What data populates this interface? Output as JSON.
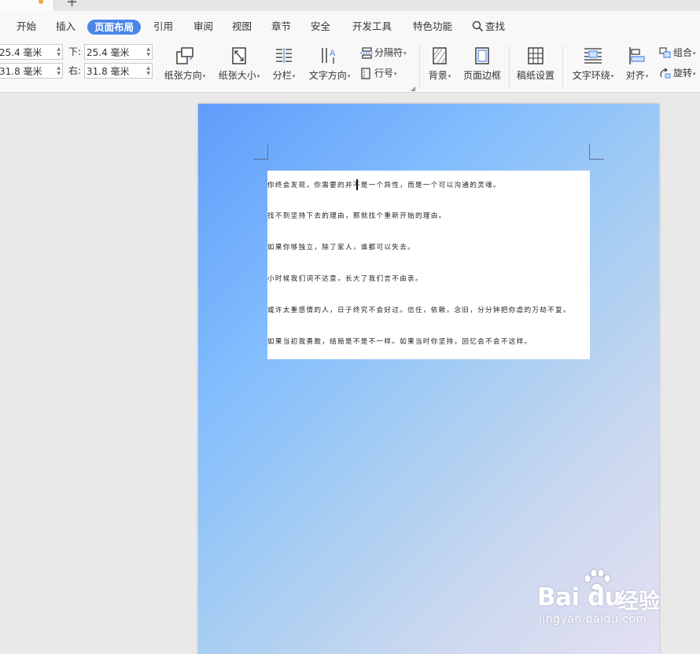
{
  "menu": {
    "items": [
      "开始",
      "插入",
      "页面布局",
      "引用",
      "审阅",
      "视图",
      "章节",
      "安全",
      "开发工具",
      "特色功能"
    ],
    "active": "页面布局",
    "search_label": "查找"
  },
  "margins": {
    "top_value": "25.4 毫米",
    "left_value": "31.8 毫米",
    "bottom_label": "下:",
    "bottom_value": "25.4 毫米",
    "right_label": "右:",
    "right_value": "31.8 毫米"
  },
  "toolbar": {
    "orientation": "纸张方向",
    "size": "纸张大小",
    "columns": "分栏",
    "text_direction": "文字方向",
    "breaks": "分隔符",
    "line_numbers": "行号",
    "background": "背景",
    "page_border": "页面边框",
    "manuscript": "稿纸设置",
    "wrap_text": "文字环绕",
    "align": "对齐",
    "group": "组合",
    "rotate": "旋转"
  },
  "document": {
    "lines": [
      "你终会发现，你需要的并不是一个异性，而是一个可以沟通的灵魂。",
      "找不到坚持下去的理由，那就找个重新开始的理由。",
      "如果你够独立，除了家人，谁都可以失去。",
      "小时候我们词不达意，长大了我们言不由衷。",
      "或许太重感情的人，日子终究不会好过。信任，依赖，念旧，分分钟把你虐的万劫不复。",
      "如果当初我勇敢，结局是不是不一样。如果当时你坚持，回忆会不会不这样。"
    ]
  },
  "watermark": {
    "brand": "Bai du",
    "cn": "经验",
    "url": "jingyan.baidu.com"
  },
  "colors": {
    "accent": "#4a86e8",
    "page_gradient_start": "#5f9dfb",
    "page_gradient_end": "#e4e0f3"
  }
}
